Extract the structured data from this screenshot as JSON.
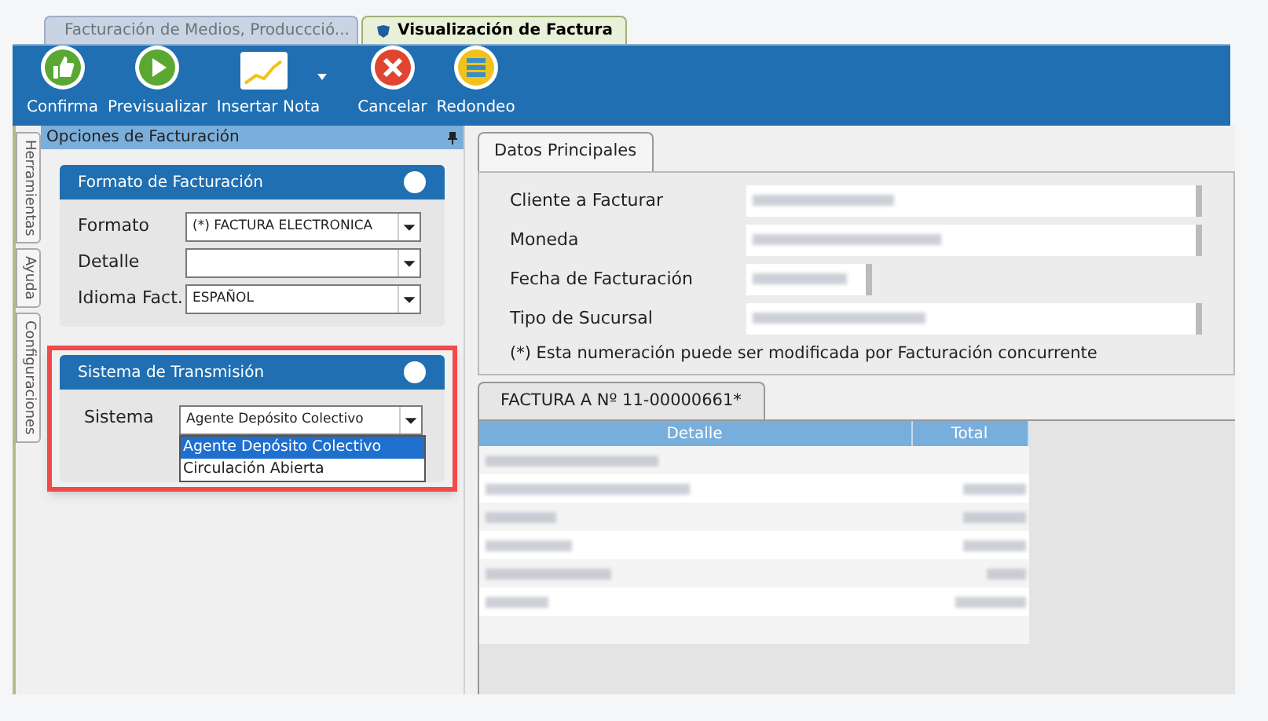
{
  "doc_tabs": [
    {
      "label": "Facturación de Medios, Produccció...",
      "selected": false
    },
    {
      "label": "Visualización de Factura",
      "selected": true
    }
  ],
  "toolbar": [
    {
      "label": "Confirma",
      "kind": "thumb"
    },
    {
      "label": "Previsualizar",
      "kind": "play"
    },
    {
      "label": "Insertar Nota",
      "kind": "chart",
      "dropdown": true
    },
    {
      "label": "Cancelar",
      "kind": "cancel"
    },
    {
      "label": "Redondeo",
      "kind": "coins"
    }
  ],
  "side_tabs": [
    "Herramientas",
    "Ayuda",
    "Configuraciones"
  ],
  "options_panel": {
    "title": "Opciones de Facturación",
    "formato": {
      "title": "Formato de Facturación",
      "fields": [
        {
          "label": "Formato",
          "value": "(*) FACTURA ELECTRONICA"
        },
        {
          "label": "Detalle"
        },
        {
          "label": "Idioma Fact.",
          "value": "ESPAÑOL"
        }
      ]
    },
    "transmision": {
      "title": "Sistema de Transmisión",
      "highlighted": true,
      "field": {
        "label": "Sistema",
        "value": "Agente Depósito Colectivo",
        "expanded": true,
        "options": [
          {
            "label": "Agente Depósito Colectivo",
            "selected": true
          },
          {
            "label": "Circulación Abierta",
            "selected": false
          }
        ]
      }
    }
  },
  "main_tab": {
    "label": "Datos Principales",
    "fields": [
      {
        "label": "Cliente a Facturar",
        "value_redacted": true
      },
      {
        "label": "Moneda",
        "value_redacted": true
      },
      {
        "label": "Fecha de Facturación",
        "value_redacted": true
      },
      {
        "label": "Tipo de Sucursal",
        "value_redacted": true
      }
    ],
    "note": "(*) Esta numeración puede ser modificada por Facturación concurrente"
  },
  "invoice": {
    "tab": "FACTURA A Nº 11-00000661*",
    "columns": [
      "Detalle",
      "Total"
    ],
    "rows": [
      {
        "detalle_redacted": true,
        "total_redacted": false
      },
      {
        "detalle_redacted": true,
        "total_redacted": true
      },
      {
        "detalle_redacted": true,
        "total_redacted": true
      },
      {
        "detalle_redacted": true,
        "total_redacted": true
      },
      {
        "detalle_redacted": true,
        "total_redacted": true
      },
      {
        "detalle_redacted": true,
        "total_redacted": true
      }
    ]
  }
}
